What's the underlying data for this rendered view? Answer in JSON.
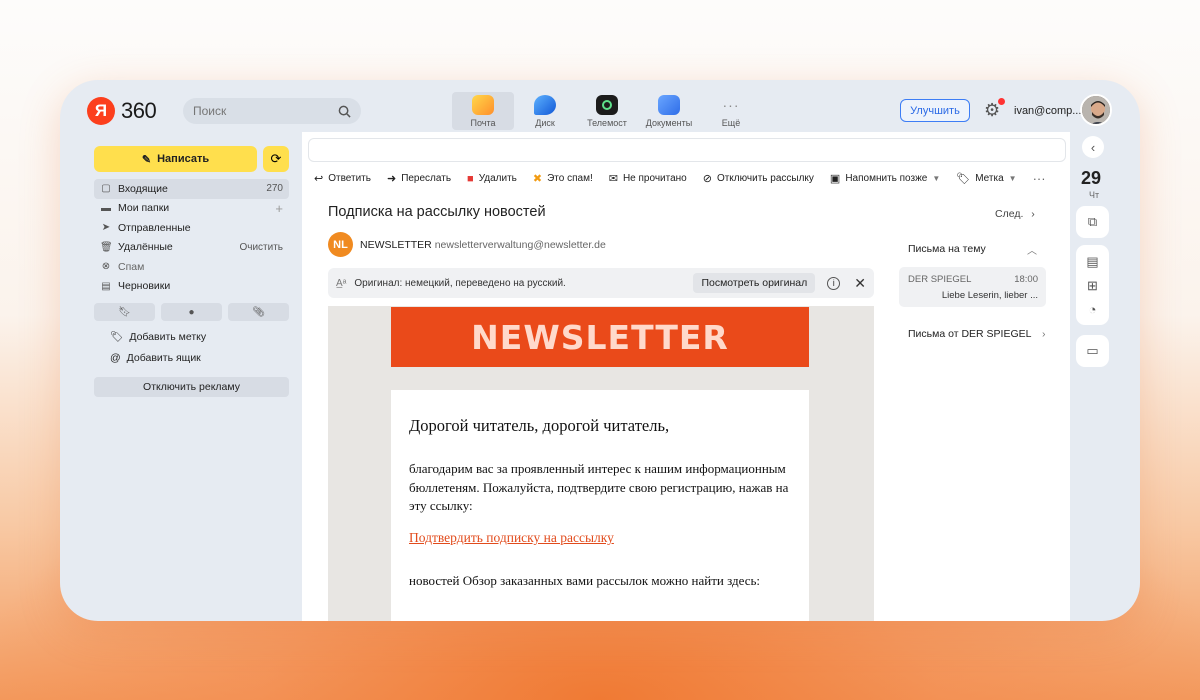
{
  "header": {
    "logo_mark": "Я",
    "logo_text": "360",
    "search_placeholder": "Поиск",
    "apps": [
      {
        "label": "Почта",
        "color": "#ffcc33",
        "icon": "mail-app-icon",
        "active": true
      },
      {
        "label": "Диск",
        "color": "#2a7bf0",
        "icon": "disk-app-icon",
        "active": false
      },
      {
        "label": "Телемост",
        "color": "#1c1c1c",
        "icon": "telemost-app-icon",
        "active": false
      },
      {
        "label": "Документы",
        "color": "#3d83f5",
        "icon": "documents-app-icon",
        "active": false
      },
      {
        "label": "Ещё",
        "color": "#e6ebf2",
        "icon": "more-app-icon",
        "active": false
      }
    ],
    "upgrade_label": "Улучшить",
    "user": "ivan@comp..."
  },
  "sidebar": {
    "compose_label": "Написать",
    "folders": [
      {
        "label": "Входящие",
        "count": "270",
        "icon": "inbox-icon",
        "active": true
      },
      {
        "label": "Мои папки",
        "count": "+",
        "icon": "folder-icon",
        "active": false
      },
      {
        "label": "Отправленные",
        "count": "",
        "icon": "sent-icon",
        "active": false
      },
      {
        "label": "Удалённые",
        "count": "Очистить",
        "icon": "trash-icon",
        "active": false
      },
      {
        "label": "Спам",
        "count": "",
        "icon": "spam-icon",
        "active": false,
        "muted": true
      },
      {
        "label": "Черновики",
        "count": "",
        "icon": "drafts-icon",
        "active": false
      }
    ],
    "add_label": "Добавить метку",
    "add_mailbox": "Добавить ящик",
    "disable_ads": "Отключить рекламу"
  },
  "toolbar": [
    {
      "label": "Ответить",
      "icon": "reply-icon"
    },
    {
      "label": "Переслать",
      "icon": "forward-icon"
    },
    {
      "label": "Удалить",
      "icon": "delete-icon"
    },
    {
      "label": "Это спам!",
      "icon": "spam-icon"
    },
    {
      "label": "Не прочитано",
      "icon": "unread-icon"
    },
    {
      "label": "Отключить рассылку",
      "icon": "unsubscribe-icon"
    },
    {
      "label": "Напомнить позже",
      "icon": "remind-icon"
    },
    {
      "label": "Метка",
      "icon": "label-icon"
    }
  ],
  "message": {
    "subject": "Подписка на рассылку новостей",
    "next_label": "След.",
    "avatar_initials": "NL",
    "sender_name": "NEWSLETTER",
    "sender_email": "newsletterverwaltung@newsletter.de",
    "translation_note": "Оригинал: немецкий, переведено на русский.",
    "view_original": "Посмотреть оригинал",
    "banner": "NEWSLETTER",
    "greeting": "Дорогой читатель, дорогой читатель,",
    "paragraph1": "благодарим вас за проявленный интерес к нашим информационным бюллетеням. Пожалуйста, подтвердите свою регистрацию, нажав на эту ссылку:",
    "confirm_link": "Подтвердить подписку на рассылку",
    "paragraph2": "новостей Обзор заказанных вами рассылок можно найти здесь:"
  },
  "thread": {
    "title": "Письма на тему",
    "item_sender": "DER SPIEGEL",
    "item_time": "18:00",
    "item_snippet": "Liebe Leserin, lieber ...",
    "from_link": "Письма от DER SPIEGEL"
  },
  "rail": {
    "day": "29",
    "weekday": "Чт"
  },
  "colors": {
    "accent_yellow": "#ffdf4d",
    "brand_red": "#fc3f1d",
    "newsletter_orange": "#ea4a1a",
    "link": "#e24b1c"
  }
}
